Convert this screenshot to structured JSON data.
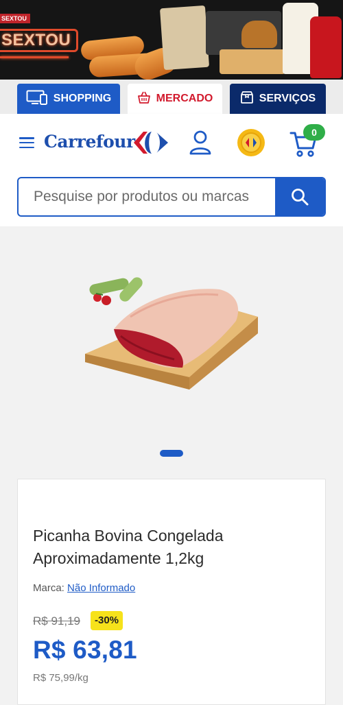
{
  "banner": {
    "promo_tag": "SEXTOU",
    "sextou_text": "SEXTOU"
  },
  "tabs": [
    {
      "label": "SHOPPING",
      "icon": "monitor-phone-icon"
    },
    {
      "label": "MERCADO",
      "icon": "basket-icon"
    },
    {
      "label": "SERVIÇOS",
      "icon": "gift-box-icon"
    }
  ],
  "header": {
    "logo_text": "Carrefour",
    "cart_count": "0",
    "icons": [
      "menu-icon",
      "carrefour-logo-icon",
      "user-icon",
      "coin-icon",
      "cart-icon"
    ]
  },
  "search": {
    "placeholder": "Pesquise por produtos ou marcas"
  },
  "product": {
    "title": "Picanha Bovina Congelada Aproximadamente 1,2kg",
    "brand_label": "Marca:",
    "brand_value": "Não Informado",
    "old_price": "R$ 91,19",
    "discount": "-30%",
    "price": "R$ 63,81",
    "unit_price": "R$ 75,99/kg",
    "image_index": 1,
    "image_count": 1
  },
  "colors": {
    "brand_blue": "#1e5bc6",
    "dark_blue": "#0b2a6a",
    "mercado_red": "#d21a2d",
    "badge_green": "#2fae48",
    "discount_yellow": "#f6e21b"
  }
}
